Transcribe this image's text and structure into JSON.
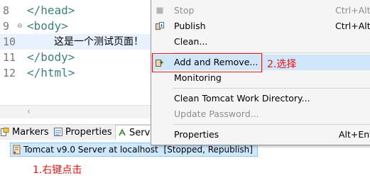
{
  "editor": {
    "lines": [
      {
        "num": "8",
        "code": "</head>"
      },
      {
        "num": "9",
        "code": "<body>",
        "fold": "⊖"
      },
      {
        "num": "10",
        "code": "这是一个测试页面！"
      },
      {
        "num": "11",
        "code": "</body>"
      },
      {
        "num": "12",
        "code": "</html>"
      }
    ]
  },
  "tabs": {
    "markers": "Markers",
    "properties": "Properties",
    "servers": "Servers"
  },
  "servers_view": {
    "server_name": "Tomcat v9.0 Server at localhost",
    "server_status": "[Stopped, Republish]"
  },
  "annotations": {
    "step1": "1.右键点击",
    "step2": "2.选择"
  },
  "context_menu": {
    "stop": {
      "label": "Stop",
      "shortcut": "Ctrl+Alt+S"
    },
    "publish": {
      "label": "Publish",
      "shortcut": "Ctrl+Alt+P"
    },
    "clean": {
      "label": "Clean..."
    },
    "add_remove": {
      "label": "Add and Remove..."
    },
    "monitoring": {
      "label": "Monitoring"
    },
    "clean_work_dir": {
      "label": "Clean Tomcat Work Directory..."
    },
    "update_password": {
      "label": "Update Password..."
    },
    "properties": {
      "label": "Properties",
      "shortcut": "Alt+Enter"
    }
  },
  "colors": {
    "annotation_red": "#e21919",
    "selection_blue": "#cde8ff",
    "menu_highlight": "#cfe6fb",
    "xml_tag": "#3f7f7f"
  }
}
